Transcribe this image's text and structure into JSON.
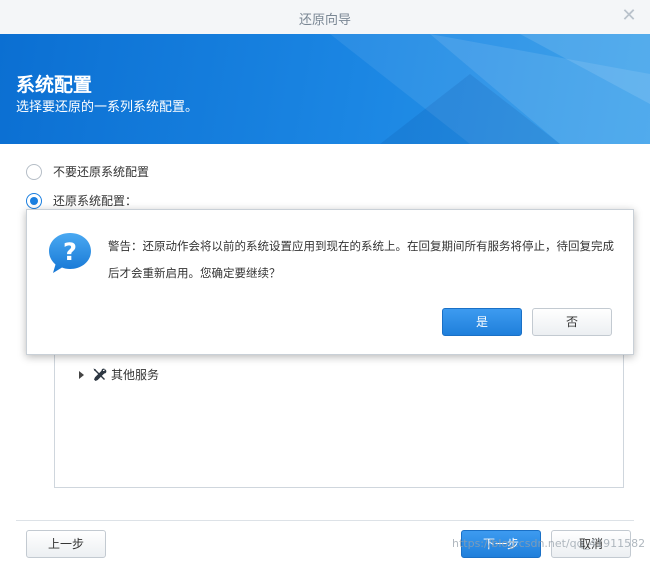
{
  "window": {
    "title": "还原向导",
    "close_icon": "close-icon"
  },
  "banner": {
    "title": "系统配置",
    "subtitle": "选择要还原的一系列系统配置。"
  },
  "options": [
    {
      "label": "不要还原系统配置",
      "checked": false
    },
    {
      "label": "还原系统配置：",
      "checked": true
    }
  ],
  "tree": {
    "items": [
      {
        "label": "其他服务",
        "icon": "wrench-screwdriver-icon"
      }
    ]
  },
  "dialog": {
    "icon": "question-icon",
    "message": "警告：还原动作会将以前的系统设置应用到现在的系统上。在回复期间所有服务将停止，待回复完成后才会重新启用。您确定要继续？",
    "yes_label": "是",
    "no_label": "否"
  },
  "footer": {
    "prev_label": "上一步",
    "next_label": "下一步",
    "cancel_label": "取消"
  },
  "watermark": "https://blog.csdn.net/qq_41911582",
  "colors": {
    "accent": "#1a7fe0",
    "banner": "#1683e0"
  }
}
